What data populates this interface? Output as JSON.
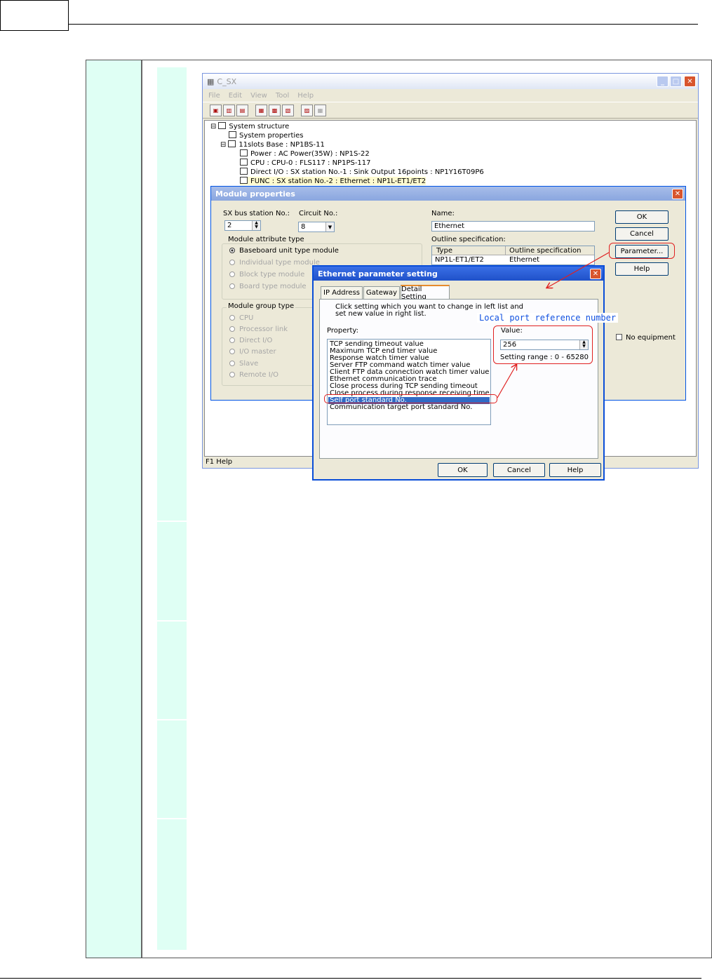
{
  "main_window": {
    "title": "C_SX",
    "menu": [
      "File",
      "Edit",
      "View",
      "Tool",
      "Help"
    ],
    "status": "F1 Help",
    "tree": [
      "System structure",
      "System properties",
      "11slots Base : NP1BS-11",
      "Power : AC Power(35W) : NP1S-22",
      "CPU : CPU-0 : FLS117 : NP1PS-117",
      "Direct I/O : SX station No.-1 : Sink Output 16points : NP1Y16T09P6",
      "FUNC : SX station No.-2 : Ethernet : NP1L-ET1/ET2"
    ]
  },
  "module_properties": {
    "title": "Module properties",
    "sx_bus_label": "SX bus station No.:",
    "sx_bus_value": "2",
    "circuit_label": "Circuit No.:",
    "circuit_value": "8",
    "name_label": "Name:",
    "name_value": "Ethernet",
    "outline_label": "Outline specification:",
    "outline_headers": [
      "Type",
      "Outline specification"
    ],
    "outline_row": [
      "NP1L-ET1/ET2",
      "Ethernet"
    ],
    "attr_group": "Module attribute type",
    "attr_options": [
      "Baseboard unit type module",
      "Individual type module",
      "Block type module",
      "Board type module"
    ],
    "group_group": "Module group type",
    "group_options": [
      "CPU",
      "Processor link",
      "Direct I/O",
      "I/O master",
      "Slave",
      "Remote I/O"
    ],
    "no_equipment": "No equipment",
    "ok": "OK",
    "cancel": "Cancel",
    "parameter": "Parameter...",
    "help": "Help"
  },
  "ethernet_dialog": {
    "title": "Ethernet parameter setting",
    "tabs": [
      "IP Address",
      "Gateway",
      "Detail Setting"
    ],
    "instruction_1": "Click setting which you want to change in left list and",
    "instruction_2": "set new value in right list.",
    "property_label": "Property:",
    "properties": [
      "TCP sending timeout value",
      "Maximum TCP end timer value",
      "Response watch timer value",
      "Server FTP command watch timer value",
      "Client FTP data connection watch timer value",
      "Ethernet communication trace",
      "Close process during TCP sending timeout",
      "Close process during response receiving timeou",
      "Self port standard No.",
      "Communication target port standard No."
    ],
    "value_label": "Value:",
    "value": "256",
    "range": "Setting range : 0 - 65280",
    "ok": "OK",
    "cancel": "Cancel",
    "help": "Help"
  },
  "annotation": {
    "callout": "Local  port reference number"
  }
}
